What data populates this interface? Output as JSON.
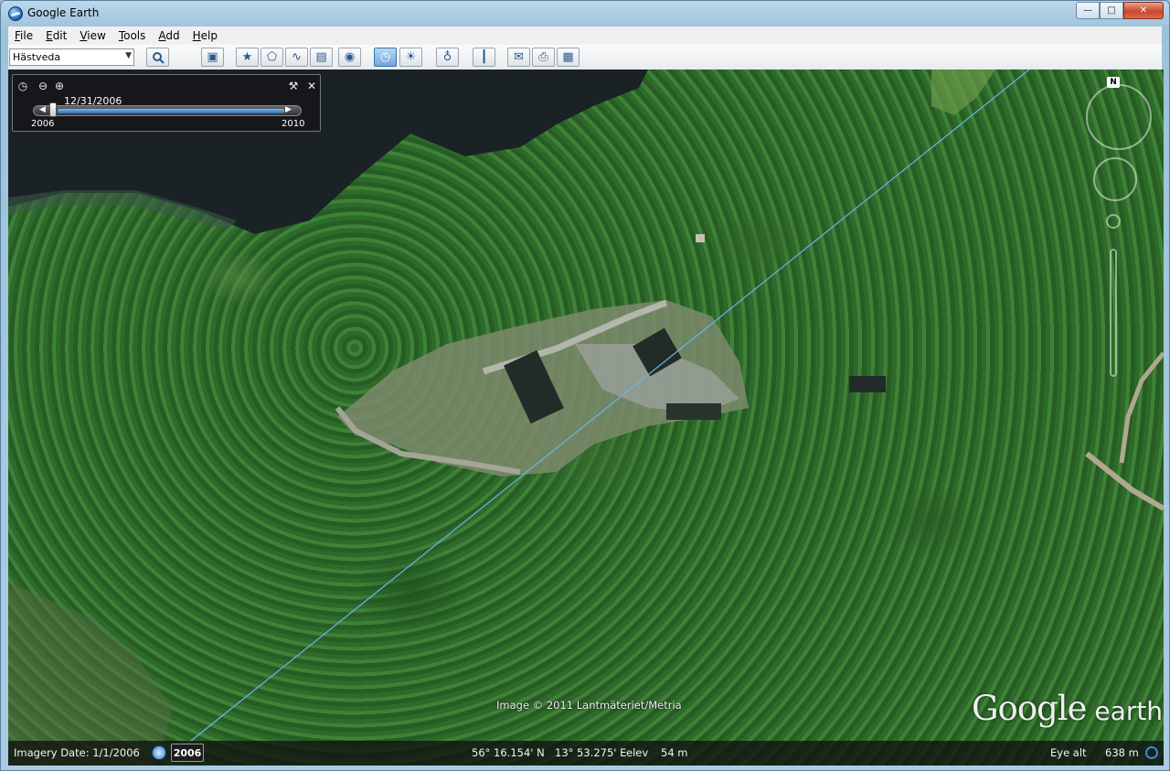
{
  "window": {
    "title": "Google Earth",
    "minimize": "—",
    "maximize": "□",
    "close": "✕"
  },
  "menu": [
    {
      "accel": "F",
      "rest": "ile"
    },
    {
      "accel": "E",
      "rest": "dit"
    },
    {
      "accel": "V",
      "rest": "iew"
    },
    {
      "accel": "T",
      "rest": "ools"
    },
    {
      "accel": "A",
      "rest": "dd"
    },
    {
      "accel": "H",
      "rest": "elp"
    }
  ],
  "toolbar": {
    "search_value": "Hästveda",
    "dropdown_icon": "▼",
    "search_icon": "search-icon",
    "buttons": [
      {
        "name": "sidebar-toggle-button",
        "icon": "sidebar-icon",
        "glyph": "▣"
      },
      {
        "name": "add-placemark-button",
        "icon": "placemark-icon",
        "glyph": "★"
      },
      {
        "name": "add-polygon-button",
        "icon": "polygon-icon",
        "glyph": "⬠"
      },
      {
        "name": "add-path-button",
        "icon": "path-icon",
        "glyph": "∿"
      },
      {
        "name": "add-overlay-button",
        "icon": "image-overlay-icon",
        "glyph": "▤"
      },
      {
        "name": "record-tour-button",
        "icon": "record-tour-icon",
        "glyph": "◉"
      },
      {
        "name": "historical-imagery-button",
        "icon": "clock-icon",
        "glyph": "◷",
        "active": true
      },
      {
        "name": "sunlight-button",
        "icon": "sun-icon",
        "glyph": "☀"
      },
      {
        "name": "planets-button",
        "icon": "planet-icon",
        "glyph": "♁"
      },
      {
        "name": "ruler-button",
        "icon": "ruler-icon",
        "glyph": "┃"
      },
      {
        "name": "email-button",
        "icon": "email-icon",
        "glyph": "✉"
      },
      {
        "name": "print-button",
        "icon": "print-icon",
        "glyph": "⎙"
      },
      {
        "name": "view-in-maps-button",
        "icon": "maps-icon",
        "glyph": "▦"
      }
    ]
  },
  "timebar": {
    "current_date": "12/31/2006",
    "start_year": "2006",
    "end_year": "2010",
    "position": 0.05,
    "icons": {
      "clock": "◷",
      "zoom_out": "⊖",
      "zoom_in": "⊕",
      "settings": "⚒",
      "close": "✕",
      "prev": "◀",
      "next": "▶"
    }
  },
  "navigation": {
    "north_label": "N"
  },
  "map": {
    "copyright": "Image © 2011 Lantmäteriet/Metria",
    "brand_main": "Google",
    "brand_sub": " earth"
  },
  "status": {
    "imagery_date": "Imagery Date: 1/1/2006",
    "year_button": "2006",
    "lat": "56° 16.154' N",
    "lon": "13° 53.275' E",
    "elev_label": "elev",
    "elev_value": "54 m",
    "eye_alt_label": "Eye alt",
    "eye_alt_value": "638 m"
  },
  "colors": {
    "accent": "#2f6fb3",
    "forest": "#356f30",
    "water": "#1b2226",
    "power_line": "#6ab4f0"
  }
}
